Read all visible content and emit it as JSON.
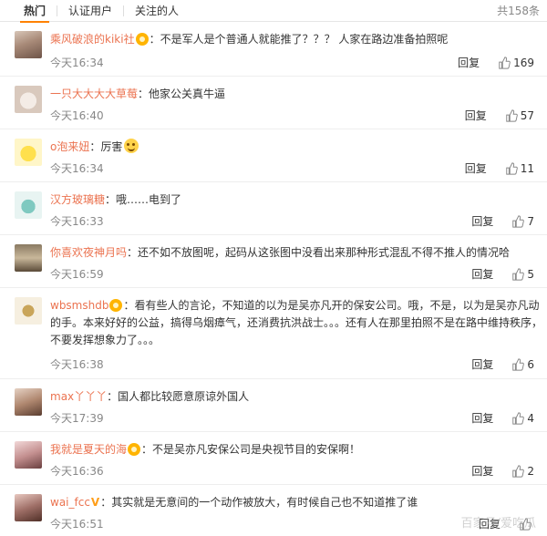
{
  "tabs": [
    {
      "label": "热门",
      "active": true
    },
    {
      "label": "认证用户",
      "active": false
    },
    {
      "label": "关注的人",
      "active": false
    }
  ],
  "total_count": "共158条",
  "reply_label": "回复",
  "colors": {
    "accent": "#ff8200",
    "username": "#eb7350",
    "meta": "#888888"
  },
  "comments": [
    {
      "user": "乘风破浪的kiki社",
      "badge": "member",
      "text": "：不是军人是个普通人就能推了？？？ 人家在路边准备拍照呢",
      "time": "今天16:34",
      "likes": "169"
    },
    {
      "user": "一只大大大大草莓",
      "badge": "",
      "text": "：他家公关真牛逼",
      "time": "今天16:40",
      "likes": "57"
    },
    {
      "user": "o泡来妞",
      "badge": "",
      "text": "：厉害",
      "emoji": "smile-emoji",
      "time": "今天16:34",
      "likes": "11"
    },
    {
      "user": "汉方玻璃糖",
      "badge": "",
      "text": "：哦……电到了",
      "time": "今天16:33",
      "likes": "7"
    },
    {
      "user": "你喜欢夜神月吗",
      "badge": "",
      "text": "：还不如不放图呢，起码从这张图中没看出来那种形式混乱不得不推人的情况哈",
      "time": "今天16:59",
      "likes": "5"
    },
    {
      "user": "wbsmshdb",
      "badge": "member",
      "text": "：看有些人的言论，不知道的以为是吴亦凡开的保安公司。哦，不是，以为是吴亦凡动的手。本来好好的公益，搞得乌烟瘴气，还消费抗洪战士。。。还有人在那里拍照不是在路中维持秩序，不要发挥想象力了。。。",
      "time": "今天16:38",
      "likes": "6"
    },
    {
      "user": "max丫丫丫",
      "badge": "",
      "text": "：国人都比较愿意原谅外国人",
      "time": "今天17:39",
      "likes": "4"
    },
    {
      "user": "我就是夏天的海",
      "badge": "member",
      "text": "：不是吴亦凡安保公司是央视节目的安保啊！",
      "time": "今天16:36",
      "likes": "2"
    },
    {
      "user": "wai_fcc",
      "badge": "v",
      "text": "：其实就是无意间的一个动作被放大，有时候自己也不知道推了谁",
      "time": "今天16:51",
      "likes": ""
    }
  ],
  "watermark": "百家号/爱吃瓜"
}
